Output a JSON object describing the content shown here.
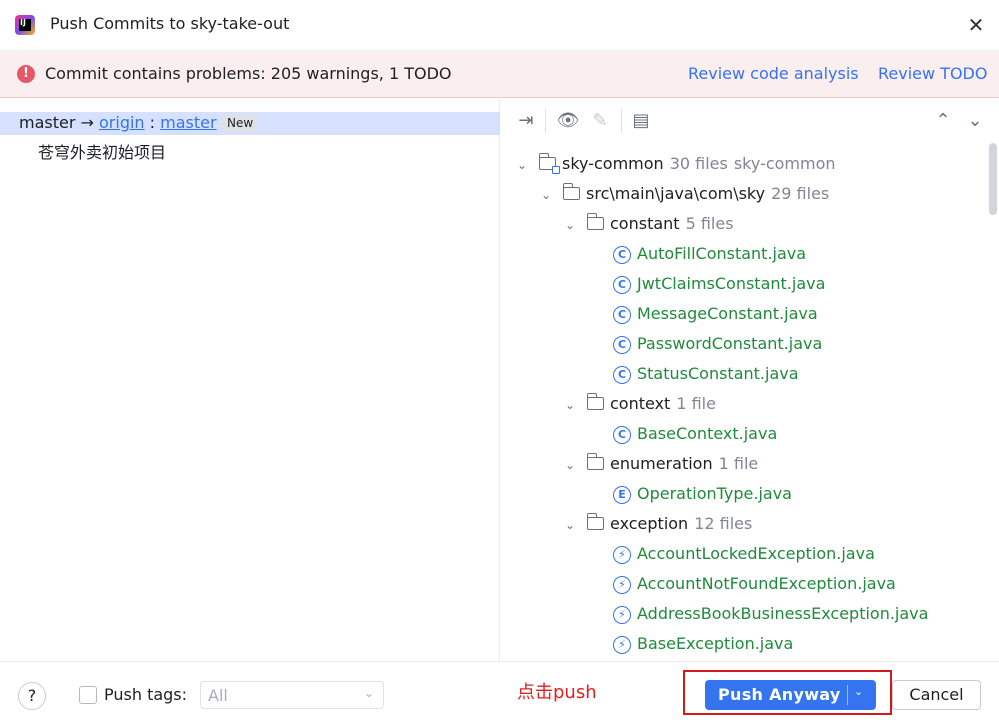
{
  "window": {
    "title": "Push Commits to sky-take-out"
  },
  "banner": {
    "message": "Commit contains problems: 205 warnings, 1 TODO",
    "review_code_link": "Review code analysis",
    "review_todo_link": "Review TODO"
  },
  "branch": {
    "local": "master",
    "arrow": "→",
    "remote": "origin",
    "separator": ":",
    "target": "master",
    "badge": "New",
    "commit": "苍穹外卖初始项目"
  },
  "tree": {
    "module": {
      "name": "sky-common",
      "count": "30 files",
      "extra": "sky-common"
    },
    "path": {
      "name": "src\\main\\java\\com\\sky",
      "count": "29 files"
    },
    "constant": {
      "name": "constant",
      "count": "5 files"
    },
    "constant_files": [
      "AutoFillConstant.java",
      "JwtClaimsConstant.java",
      "MessageConstant.java",
      "PasswordConstant.java",
      "StatusConstant.java"
    ],
    "context": {
      "name": "context",
      "count": "1 file"
    },
    "context_files": [
      "BaseContext.java"
    ],
    "enumeration": {
      "name": "enumeration",
      "count": "1 file"
    },
    "enumeration_files": [
      "OperationType.java"
    ],
    "exception": {
      "name": "exception",
      "count": "12 files"
    },
    "exception_files": [
      "AccountLockedException.java",
      "AccountNotFoundException.java",
      "AddressBookBusinessException.java",
      "BaseException.java"
    ]
  },
  "footer": {
    "help": "?",
    "push_tags_label": "Push tags:",
    "push_tags_value": "All",
    "annotation": "点击push",
    "push_button": "Push Anyway",
    "cancel_button": "Cancel"
  },
  "colors": {
    "accent": "#3574f0",
    "file_green": "#208a3c",
    "banner_bg": "#fbeeee",
    "error": "#e55765",
    "annotation_red": "#e02020"
  }
}
